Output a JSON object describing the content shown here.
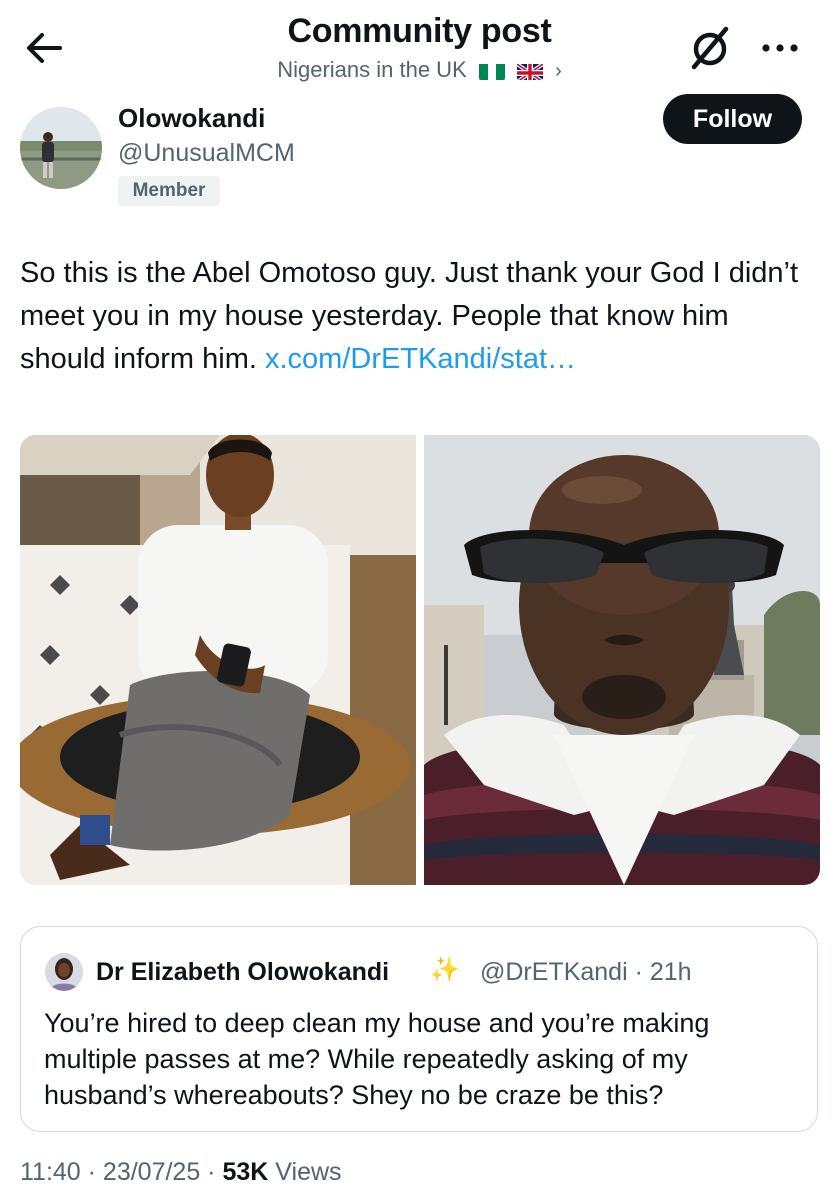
{
  "header": {
    "title": "Community post",
    "community": "Nigerians in the UK",
    "flags": [
      "nigeria-flag",
      "uk-flag"
    ]
  },
  "author": {
    "name": "Olowokandi",
    "handle": "@UnusualMCM",
    "badge": "Member",
    "follow_label": "Follow"
  },
  "post": {
    "text": "So this is the Abel Omotoso guy. Just thank your God I didn’t meet you in my house yesterday. People that know him should inform him.",
    "link": "x.com/DrETKandi/stat…"
  },
  "quote": {
    "name": "Dr Elizabeth Olowokandi",
    "handle_time": "@DrETKandi · 21h",
    "text": "You’re hired to deep clean my house and you’re making multiple passes at me? While repeatedly asking of my husband’s whereabouts? Shey no be craze be this?"
  },
  "meta": {
    "time_date": "11:40 · 23/07/25 · ",
    "views_count": "53K",
    "views_label": " Views"
  },
  "colors": {
    "text": "#0f1419",
    "secondary": "#536471",
    "link": "#1d9bf0",
    "follow_bg": "#0f1419",
    "border": "#cfd9de"
  }
}
